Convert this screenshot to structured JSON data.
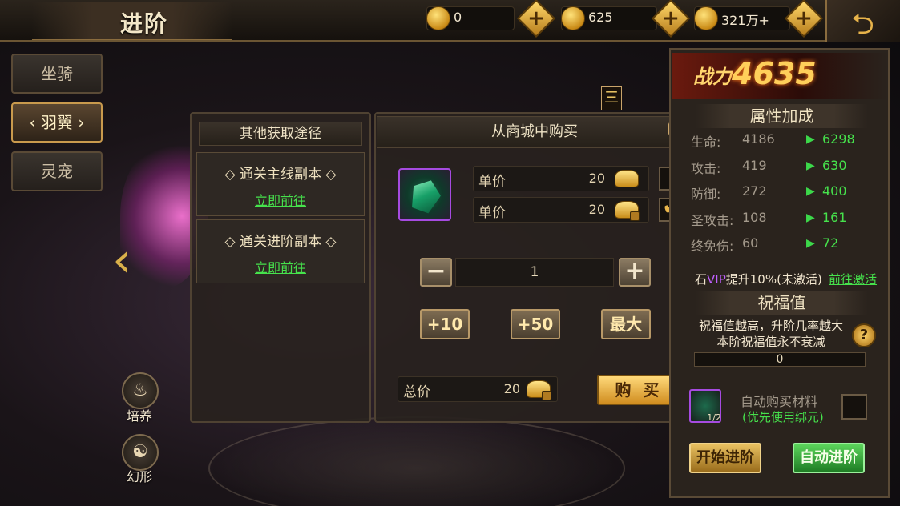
{
  "header": {
    "title": "进阶",
    "currencies": [
      {
        "icon": "gold-ingot-icon",
        "value": "0"
      },
      {
        "icon": "bound-gold-ingot-icon",
        "value": "625"
      },
      {
        "icon": "copper-coin-icon",
        "value": "321万+"
      }
    ]
  },
  "side_tabs": [
    {
      "label": "坐骑",
      "active": false
    },
    {
      "label": "羽翼",
      "active": true
    },
    {
      "label": "灵宠",
      "active": false
    }
  ],
  "side_round_buttons": [
    {
      "label": "培养",
      "icon": "flame-icon"
    },
    {
      "label": "幻形",
      "icon": "mask-icon"
    }
  ],
  "stage_marker": "三",
  "other_routes": {
    "title": "其他获取途径",
    "routes": [
      {
        "title": "◇ 通关主线副本 ◇",
        "link": "立即前往"
      },
      {
        "title": "◇ 通关进阶副本 ◇",
        "link": "立即前往"
      }
    ]
  },
  "shop_dialog": {
    "title": "从商城中购买",
    "price_rows": [
      {
        "label": "单价",
        "value": "20",
        "currency": "gold-ingot-icon",
        "checked": false
      },
      {
        "label": "单价",
        "value": "20",
        "currency": "bound-gold-ingot-icon",
        "checked": true
      }
    ],
    "quantity": "1",
    "step_buttons": [
      "+10",
      "+50",
      "最大"
    ],
    "total_label": "总价",
    "total_value": "20",
    "buy_label": "购 买"
  },
  "right_panel": {
    "power_label": "战力",
    "power_value": "4635",
    "attributes_title": "属性加成",
    "stats": [
      {
        "name": "生命:",
        "current": "4186",
        "next": "6298"
      },
      {
        "name": "攻击:",
        "current": "419",
        "next": "630"
      },
      {
        "name": "防御:",
        "current": "272",
        "next": "400"
      },
      {
        "name": "圣攻击:",
        "current": "108",
        "next": "161"
      },
      {
        "name": "终免伤:",
        "current": "60",
        "next": "72"
      }
    ],
    "vip_prefix": "石",
    "vip_word": "VIP",
    "vip_suffix": "提升10%(未激活)",
    "vip_link": "前往激活",
    "blessing_title": "祝福值",
    "blessing_desc_1": "祝福值越高，升阶几率越大",
    "blessing_desc_2": "本阶祝福值永不衰减",
    "blessing_value": "0",
    "material_count": "1/2",
    "auto_buy_label": "自动购买材料",
    "auto_buy_note": "(优先使用绑元)",
    "start_button": "开始进阶",
    "auto_button": "自动进阶"
  }
}
